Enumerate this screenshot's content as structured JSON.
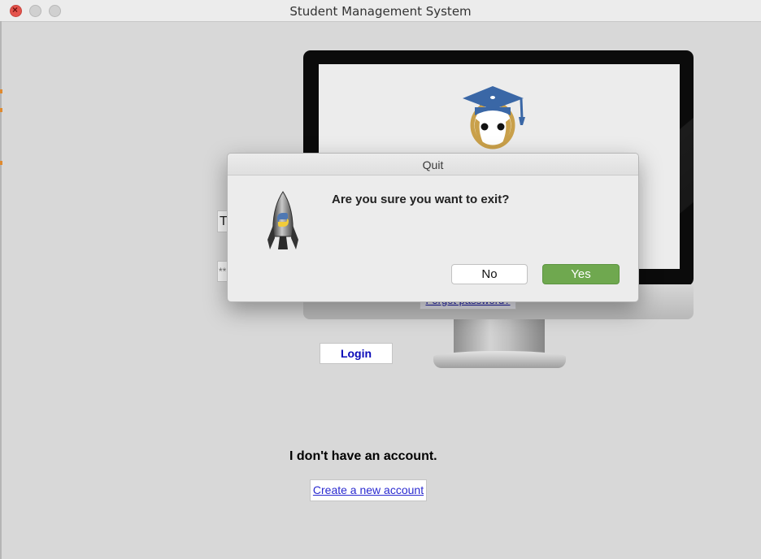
{
  "window": {
    "title": "Student Management System"
  },
  "login": {
    "username_value": "T",
    "password_value": "**",
    "forgot_password_link": "Forgot password?",
    "login_button": "Login",
    "no_account_text": "I don't have an account.",
    "create_account_link": "Create a new account"
  },
  "dialog": {
    "title": "Quit",
    "message": "Are you sure you want to exit?",
    "no_button": "No",
    "yes_button": "Yes"
  },
  "icons": {
    "close": "close-icon",
    "app": "python-rocket-icon",
    "logo": "graduate-logo-icon"
  },
  "colors": {
    "yes_button": "#6fa84f",
    "close_button": "#e4534c",
    "link": "#1a1aa6",
    "grad_cap": "#3a67a6"
  }
}
